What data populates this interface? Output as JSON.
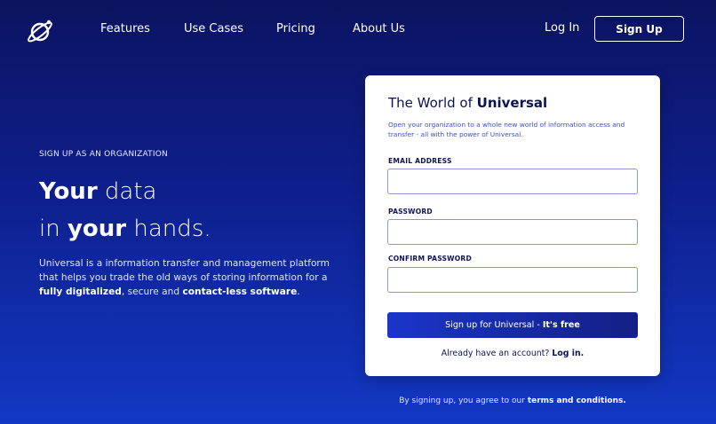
{
  "nav": {
    "logo_icon": "planet-icon",
    "links": [
      "Features",
      "Use Cases",
      "Pricing",
      "About Us"
    ],
    "login_label": "Log In",
    "signup_label": "Sign Up"
  },
  "hero": {
    "eyebrow": "SIGN UP AS AN ORGANIZATION",
    "headline_line1_bold": "Your",
    "headline_line1_rest": " data",
    "headline_line2_pre": "in ",
    "headline_line2_bold": "your",
    "headline_line2_post": " hands.",
    "desc_part1": "Universal is a information transfer and management platform that helps you trade the old ways of storing information for a ",
    "desc_bold1": "fully digitalized",
    "desc_part2": ", secure and ",
    "desc_bold2": "contact-less software",
    "desc_part3": "."
  },
  "form": {
    "title_pre": "The World of ",
    "title_bold": "Universal",
    "subtitle": "Open your organization to a whole new world of information access and transfer - all with the power of Universal.",
    "email_label": "EMAIL ADDRESS",
    "email_value": "",
    "password_label": "PASSWORD",
    "password_value": "",
    "confirm_label": "CONFIRM PASSWORD",
    "confirm_value": "",
    "submit_pre": "Sign up for Universal -",
    "submit_bold": "It's free",
    "already_text": "Already have an account? ",
    "already_link": "Log in."
  },
  "terms": {
    "text": "By signing up, you agree to our ",
    "link": "terms and conditions."
  },
  "colors": {
    "background_top": "#0c1360",
    "background_bottom": "#1238c4",
    "card": "#ffffff",
    "text_dark": "#0d1455",
    "accent": "#1a35c9"
  }
}
